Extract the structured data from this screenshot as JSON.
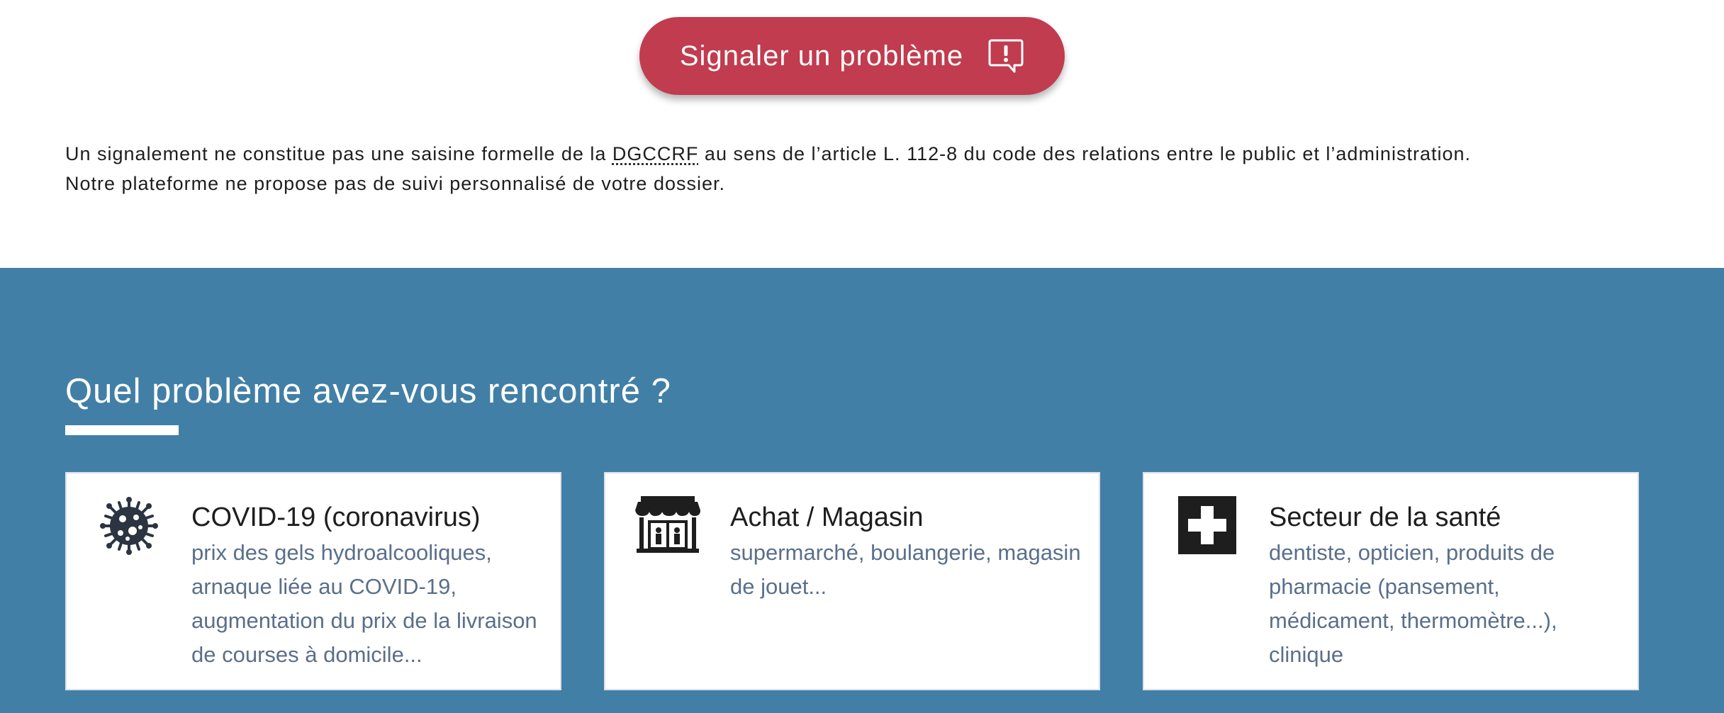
{
  "report_button": {
    "label": "Signaler un problème",
    "icon": "speech-bubble-exclamation-icon",
    "color": "#c03c4e"
  },
  "notice": {
    "line1_before": "Un signalement ne constitue pas une saisine formelle de la ",
    "abbr": "DGCCRF",
    "line1_after": " au sens de l’article L. 112-8 du code des relations entre le public et l’administration.",
    "line2": "Notre plateforme ne propose pas de suivi personnalisé de votre dossier."
  },
  "section": {
    "title": "Quel problème avez-vous rencontré ?",
    "background": "#427fa6"
  },
  "cards": [
    {
      "title": "COVID-19 (coronavirus)",
      "description": "prix des gels hydroalcooliques, arnaque liée au COVID-19, augmentation du prix de la livraison de courses à domicile...",
      "icon": "virus-icon"
    },
    {
      "title": "Achat / Magasin",
      "description": "supermarché, boulangerie, magasin de jouet...",
      "icon": "shop-icon"
    },
    {
      "title": "Secteur de la santé",
      "description": "dentiste, opticien, produits de pharmacie (pansement, médicament, thermomètre...), clinique",
      "icon": "medical-cross-icon"
    }
  ]
}
